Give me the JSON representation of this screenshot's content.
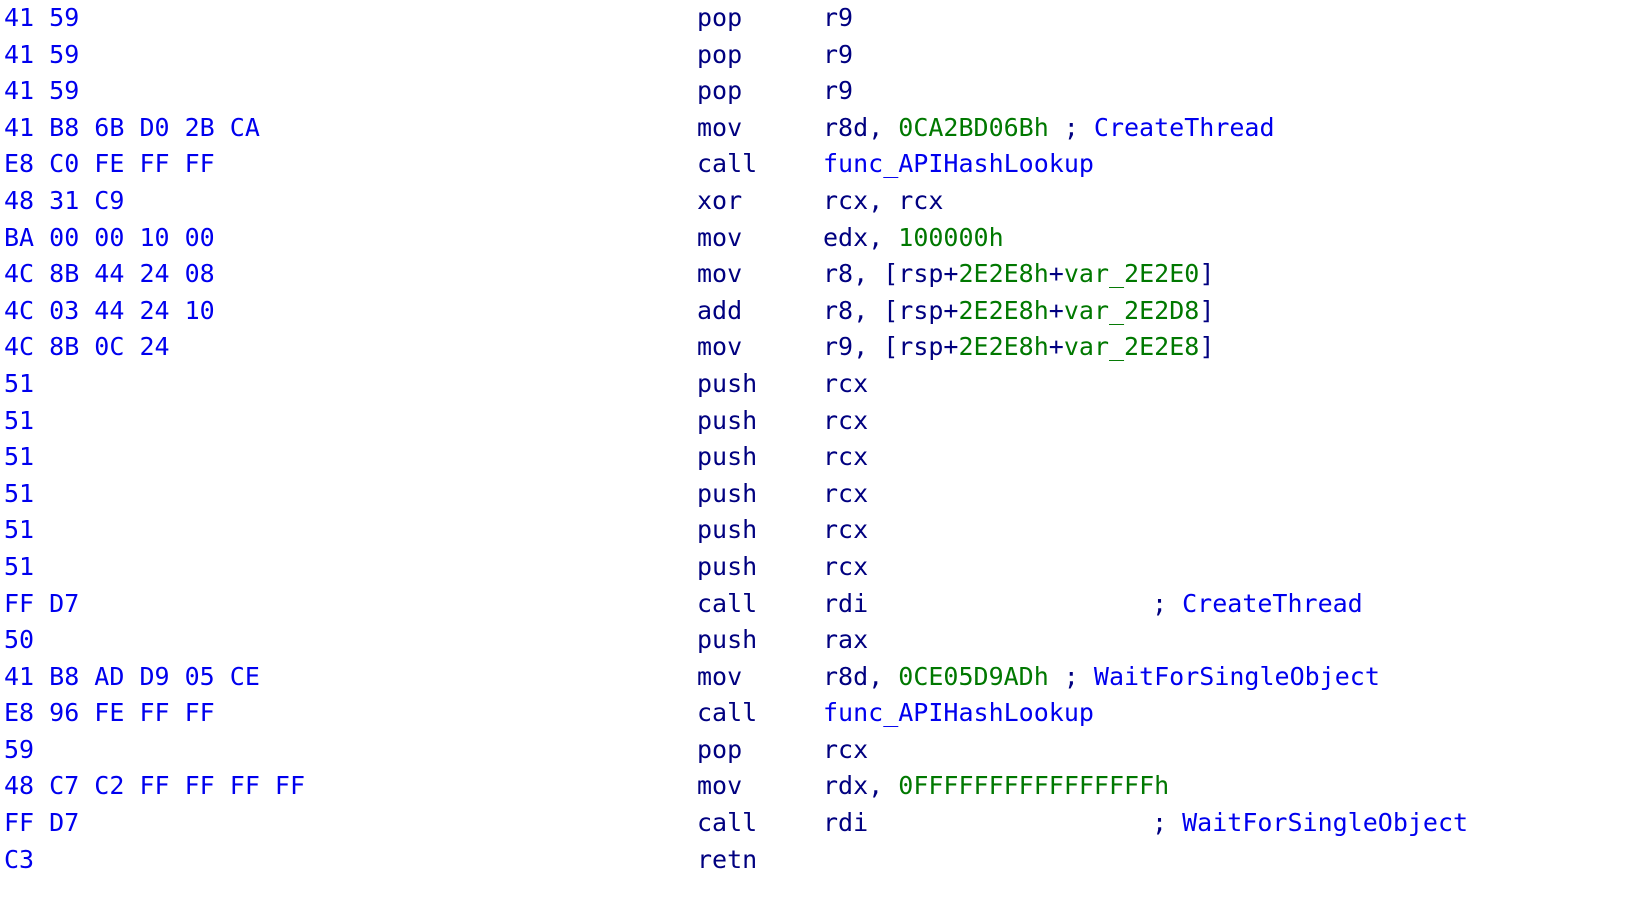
{
  "view": {
    "app": "IDA Pro disassembly listing",
    "title": "Disassembly Listing",
    "background_color": "#ffffff",
    "colors": {
      "opcode_bytes": "#0000ee",
      "mnemonic": "#000080",
      "register": "#000080",
      "immediate": "#007800",
      "stack_variable": "#007800",
      "function_name": "#0000ee",
      "comment": "#0000ee",
      "punctuation": "#000080"
    }
  },
  "columns": {
    "bytes_header": "",
    "mnemonic_header": "",
    "operands_header": "",
    "comment_header": ""
  },
  "lines": [
    {
      "bytes": "41 59",
      "mnemonic": "pop",
      "operands": [
        {
          "t": "reg",
          "v": "r9"
        }
      ],
      "comment": ""
    },
    {
      "bytes": "41 59",
      "mnemonic": "pop",
      "operands": [
        {
          "t": "reg",
          "v": "r9"
        }
      ],
      "comment": ""
    },
    {
      "bytes": "41 59",
      "mnemonic": "pop",
      "operands": [
        {
          "t": "reg",
          "v": "r9"
        }
      ],
      "comment": ""
    },
    {
      "bytes": "41 B8 6B D0 2B CA",
      "mnemonic": "mov",
      "operands": [
        {
          "t": "reg",
          "v": "r8d"
        },
        {
          "t": "punct",
          "v": ", "
        },
        {
          "t": "num",
          "v": "0CA2BD06Bh"
        }
      ],
      "comment": "CreateThread",
      "comment_inline": true
    },
    {
      "bytes": "E8 C0 FE FF FF",
      "mnemonic": "call",
      "operands": [
        {
          "t": "fn",
          "v": "func_APIHashLookup"
        }
      ],
      "comment": ""
    },
    {
      "bytes": "48 31 C9",
      "mnemonic": "xor",
      "operands": [
        {
          "t": "reg",
          "v": "rcx, rcx"
        }
      ],
      "comment": ""
    },
    {
      "bytes": "BA 00 00 10 00",
      "mnemonic": "mov",
      "operands": [
        {
          "t": "reg",
          "v": "edx"
        },
        {
          "t": "punct",
          "v": ", "
        },
        {
          "t": "num",
          "v": "100000h"
        }
      ],
      "comment": ""
    },
    {
      "bytes": "4C 8B 44 24 08",
      "mnemonic": "mov",
      "operands": [
        {
          "t": "reg",
          "v": "r8"
        },
        {
          "t": "punct",
          "v": ", [rsp+"
        },
        {
          "t": "num",
          "v": "2E2E8h"
        },
        {
          "t": "punct",
          "v": "+"
        },
        {
          "t": "num",
          "v": "var_2E2E0"
        },
        {
          "t": "punct",
          "v": "]"
        }
      ],
      "comment": ""
    },
    {
      "bytes": "4C 03 44 24 10",
      "mnemonic": "add",
      "operands": [
        {
          "t": "reg",
          "v": "r8"
        },
        {
          "t": "punct",
          "v": ", [rsp+"
        },
        {
          "t": "num",
          "v": "2E2E8h"
        },
        {
          "t": "punct",
          "v": "+"
        },
        {
          "t": "num",
          "v": "var_2E2D8"
        },
        {
          "t": "punct",
          "v": "]"
        }
      ],
      "comment": ""
    },
    {
      "bytes": "4C 8B 0C 24",
      "mnemonic": "mov",
      "operands": [
        {
          "t": "reg",
          "v": "r9"
        },
        {
          "t": "punct",
          "v": ", [rsp+"
        },
        {
          "t": "num",
          "v": "2E2E8h"
        },
        {
          "t": "punct",
          "v": "+"
        },
        {
          "t": "num",
          "v": "var_2E2E8"
        },
        {
          "t": "punct",
          "v": "]"
        }
      ],
      "comment": ""
    },
    {
      "bytes": "51",
      "mnemonic": "push",
      "operands": [
        {
          "t": "reg",
          "v": "rcx"
        }
      ],
      "comment": ""
    },
    {
      "bytes": "51",
      "mnemonic": "push",
      "operands": [
        {
          "t": "reg",
          "v": "rcx"
        }
      ],
      "comment": ""
    },
    {
      "bytes": "51",
      "mnemonic": "push",
      "operands": [
        {
          "t": "reg",
          "v": "rcx"
        }
      ],
      "comment": ""
    },
    {
      "bytes": "51",
      "mnemonic": "push",
      "operands": [
        {
          "t": "reg",
          "v": "rcx"
        }
      ],
      "comment": ""
    },
    {
      "bytes": "51",
      "mnemonic": "push",
      "operands": [
        {
          "t": "reg",
          "v": "rcx"
        }
      ],
      "comment": ""
    },
    {
      "bytes": "51",
      "mnemonic": "push",
      "operands": [
        {
          "t": "reg",
          "v": "rcx"
        }
      ],
      "comment": ""
    },
    {
      "bytes": "FF D7",
      "mnemonic": "call",
      "operands": [
        {
          "t": "reg",
          "v": "rdi"
        }
      ],
      "comment": "CreateThread",
      "comment_column": true
    },
    {
      "bytes": "50",
      "mnemonic": "push",
      "operands": [
        {
          "t": "reg",
          "v": "rax"
        }
      ],
      "comment": ""
    },
    {
      "bytes": "41 B8 AD D9 05 CE",
      "mnemonic": "mov",
      "operands": [
        {
          "t": "reg",
          "v": "r8d"
        },
        {
          "t": "punct",
          "v": ", "
        },
        {
          "t": "num",
          "v": "0CE05D9ADh"
        }
      ],
      "comment": "WaitForSingleObject",
      "comment_inline": true
    },
    {
      "bytes": "E8 96 FE FF FF",
      "mnemonic": "call",
      "operands": [
        {
          "t": "fn",
          "v": "func_APIHashLookup"
        }
      ],
      "comment": ""
    },
    {
      "bytes": "59",
      "mnemonic": "pop",
      "operands": [
        {
          "t": "reg",
          "v": "rcx"
        }
      ],
      "comment": ""
    },
    {
      "bytes": "48 C7 C2 FF FF FF FF",
      "mnemonic": "mov",
      "operands": [
        {
          "t": "reg",
          "v": "rdx"
        },
        {
          "t": "punct",
          "v": ", "
        },
        {
          "t": "num",
          "v": "0FFFFFFFFFFFFFFFFh"
        }
      ],
      "comment": ""
    },
    {
      "bytes": "FF D7",
      "mnemonic": "call",
      "operands": [
        {
          "t": "reg",
          "v": "rdi"
        }
      ],
      "comment": "WaitForSingleObject",
      "comment_column": true
    },
    {
      "bytes": "C3",
      "mnemonic": "retn",
      "operands": [],
      "comment": ""
    }
  ]
}
